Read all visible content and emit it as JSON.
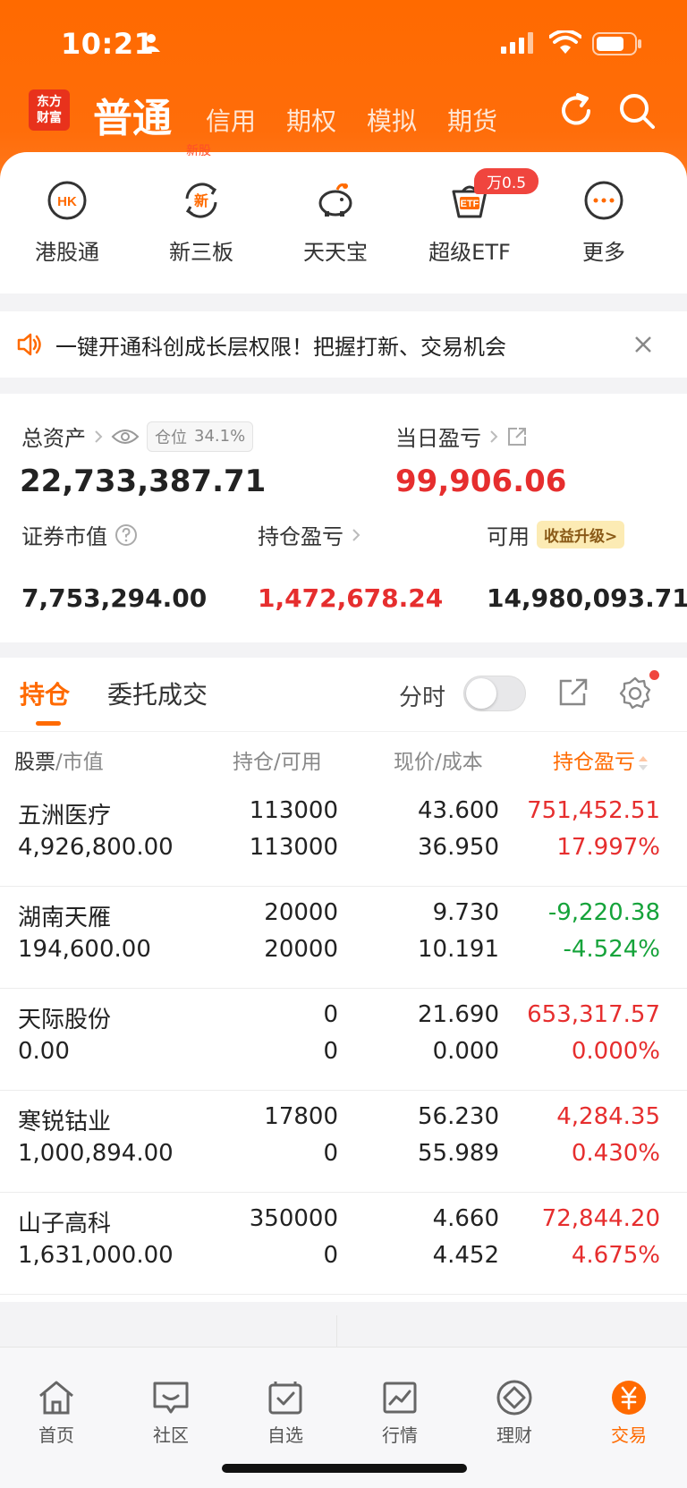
{
  "status_bar": {
    "time": "10:21"
  },
  "header": {
    "logo_line1": "东方",
    "logo_line2": "财富",
    "tabs": [
      "普通",
      "信用",
      "期权",
      "模拟",
      "期货"
    ],
    "partial_label": "新股"
  },
  "quick_menu": {
    "items": [
      {
        "icon": "hk-icon",
        "label": "港股通",
        "glyph": "HK"
      },
      {
        "icon": "xin-icon",
        "label": "新三板",
        "glyph": "新"
      },
      {
        "icon": "piggy-bank-icon",
        "label": "天天宝"
      },
      {
        "icon": "etf-icon",
        "label": "超级ETF",
        "glyph": "ETF"
      },
      {
        "icon": "more-icon",
        "label": "更多"
      }
    ],
    "etf_badge": "万0.5"
  },
  "notice": {
    "text": "一键开通科创成长层权限！把握打新、交易机会"
  },
  "assets": {
    "total_label": "总资产",
    "position_label": "仓位",
    "position_value": "34.1%",
    "total_value": "22,733,387.71",
    "daily_pl_label": "当日盈亏",
    "daily_pl_value": "99,906.06",
    "market_value_label": "证券市值",
    "market_value": "7,753,294.00",
    "holding_pl_label": "持仓盈亏",
    "holding_pl_value": "1,472,678.24",
    "available_label": "可用",
    "upgrade_label": "收益升级>",
    "available_value": "14,980,093.71"
  },
  "positions": {
    "tabs": [
      "持仓",
      "委托成交"
    ],
    "fenshi_label": "分时",
    "fenshi_enabled": false,
    "columns": {
      "c1a": "股票",
      "c1b": "市值",
      "c2a": "持仓",
      "c2b": "可用",
      "c3a": "现价",
      "c3b": "成本",
      "c4": "持仓盈亏"
    },
    "rows": [
      {
        "name": "五洲医疗",
        "market_value": "4,926,800.00",
        "holding": "113000",
        "available": "113000",
        "price": "43.600",
        "cost": "36.950",
        "pl": "751,452.51",
        "pl_pct": "17.997%",
        "trend": "up"
      },
      {
        "name": "湖南天雁",
        "market_value": "194,600.00",
        "holding": "20000",
        "available": "20000",
        "price": "9.730",
        "cost": "10.191",
        "pl": "-9,220.38",
        "pl_pct": "-4.524%",
        "trend": "down"
      },
      {
        "name": "天际股份",
        "market_value": "0.00",
        "holding": "0",
        "available": "0",
        "price": "21.690",
        "cost": "0.000",
        "pl": "653,317.57",
        "pl_pct": "0.000%",
        "trend": "up"
      },
      {
        "name": "寒锐钴业",
        "market_value": "1,000,894.00",
        "holding": "17800",
        "available": "0",
        "price": "56.230",
        "cost": "55.989",
        "pl": "4,284.35",
        "pl_pct": "0.430%",
        "trend": "up"
      },
      {
        "name": "山子高科",
        "market_value": "1,631,000.00",
        "holding": "350000",
        "available": "0",
        "price": "4.660",
        "cost": "4.452",
        "pl": "72,844.20",
        "pl_pct": "4.675%",
        "trend": "up"
      }
    ]
  },
  "tab_bar": {
    "items": [
      {
        "icon": "home-icon",
        "label": "首页"
      },
      {
        "icon": "community-icon",
        "label": "社区"
      },
      {
        "icon": "watchlist-icon",
        "label": "自选"
      },
      {
        "icon": "market-icon",
        "label": "行情"
      },
      {
        "icon": "wealth-icon",
        "label": "理财"
      },
      {
        "icon": "trade-icon",
        "label": "交易"
      }
    ],
    "active_index": 5
  },
  "colors": {
    "brand": "#ff6a00",
    "up": "#e62e2e",
    "down": "#15a33a"
  }
}
